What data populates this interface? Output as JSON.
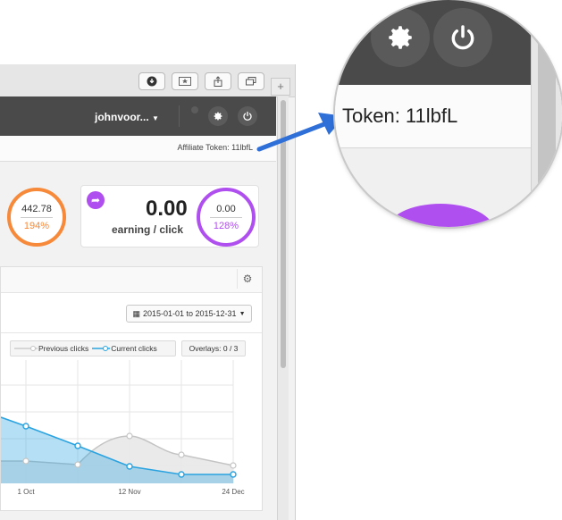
{
  "browser": {
    "toolbar_icons": [
      "download-icon",
      "star-icon",
      "share-icon",
      "tabs-icon"
    ],
    "new_tab_label": "+"
  },
  "header": {
    "username": "johnvoor...",
    "settings_icon": "gear-icon",
    "power_icon": "power-icon"
  },
  "token_bar": {
    "text": "Affiliate Token: 11lbfL"
  },
  "stats": {
    "left": {
      "value": "442.78",
      "percent": "194%",
      "color": "#f6893a"
    },
    "card": {
      "value": "0.00",
      "label": "earning / click",
      "icon": "share-arrow-icon"
    },
    "right": {
      "value": "0.00",
      "percent": "128%",
      "color": "#b04fef"
    }
  },
  "panel": {
    "date_range": "2015-01-01 to 2015-12-31",
    "legend_previous": "Previous clicks",
    "legend_current": "Current clicks",
    "overlays": "Overlays: 0 / 3"
  },
  "chart_data": {
    "type": "area",
    "categories": [
      "1 Oct",
      "12 Nov",
      "24 Dec"
    ],
    "series": [
      {
        "name": "Current clicks",
        "color": "#2aa3e0"
      },
      {
        "name": "Previous clicks",
        "color": "#c4c4c4"
      }
    ]
  },
  "magnifier": {
    "text": "Token: 11lbfL"
  },
  "colors": {
    "accent_blue": "#2f6fd8",
    "dark_bar": "#4a4a4a"
  }
}
